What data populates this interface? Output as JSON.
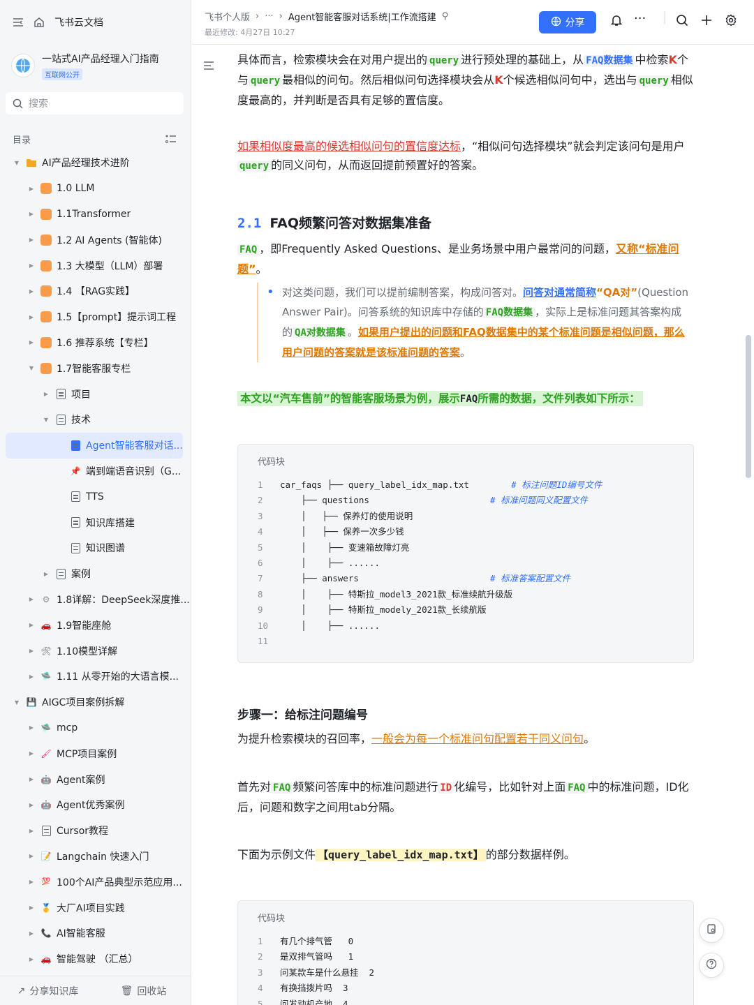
{
  "sidebar": {
    "brand": "飞书云文档",
    "kb_title": "一站式AI产品经理入门指南",
    "kb_tag": "互联网公开",
    "search_placeholder": "搜索",
    "toc_label": "目录",
    "items": [
      {
        "label": "AI产品经理技术进阶",
        "level": 0,
        "expanded": true,
        "icon": "folder-icon",
        "color": "#f5a623"
      },
      {
        "label": "1.0 LLM",
        "level": 1,
        "icon": "doc-orange-icon",
        "color": "#f89b4b"
      },
      {
        "label": "1.1Transformer",
        "level": 1,
        "icon": "doc-orange-icon",
        "color": "#f89b4b"
      },
      {
        "label": "1.2 AI Agents (智能体)",
        "level": 1,
        "icon": "doc-orange-icon",
        "color": "#f89b4b"
      },
      {
        "label": "1.3 大模型（LLM）部署",
        "level": 1,
        "icon": "doc-orange-icon",
        "color": "#f89b4b"
      },
      {
        "label": "1.4 【RAG实践】",
        "level": 1,
        "icon": "doc-orange-icon",
        "color": "#f89b4b"
      },
      {
        "label": "1.5【prompt】提示词工程",
        "level": 1,
        "icon": "doc-orange-icon",
        "color": "#f89b4b"
      },
      {
        "label": "1.6 推荐系统【专栏】",
        "level": 1,
        "icon": "doc-orange-icon",
        "color": "#f89b4b"
      },
      {
        "label": "1.7智能客服专栏",
        "level": 1,
        "expanded": true,
        "icon": "doc-orange-icon",
        "color": "#f89b4b"
      },
      {
        "label": "项目",
        "level": 2,
        "icon": "doc-icon"
      },
      {
        "label": "技术",
        "level": 2,
        "expanded": true,
        "icon": "doc-icon"
      },
      {
        "label": "Agent智能客服对话...",
        "level": 3,
        "active": true,
        "icon": "doc-blue-icon"
      },
      {
        "label": "端到端语音识别（G...",
        "level": 3,
        "icon": "pin-icon"
      },
      {
        "label": "TTS",
        "level": 3,
        "icon": "doc-icon"
      },
      {
        "label": "知识库搭建",
        "level": 3,
        "icon": "doc-icon"
      },
      {
        "label": "知识图谱",
        "level": 3,
        "icon": "doc-icon"
      },
      {
        "label": "案例",
        "level": 2,
        "icon": "doc-icon"
      },
      {
        "label": "1.8详解：DeepSeek深度推...",
        "level": 1,
        "icon": "gear-icon"
      },
      {
        "label": "1.9智能座舱",
        "level": 1,
        "icon": "car-icon"
      },
      {
        "label": "1.10模型详解",
        "level": 1,
        "icon": "tools-icon"
      },
      {
        "label": "1.11 从零开始的大语言模...",
        "level": 1,
        "icon": "ufo-icon"
      },
      {
        "label": "AIGC项目案例拆解",
        "level": 0,
        "expanded": true,
        "icon": "save-icon"
      },
      {
        "label": "mcp",
        "level": 1,
        "icon": "ufo-icon"
      },
      {
        "label": "MCP项目案例",
        "level": 1,
        "icon": "brush-icon"
      },
      {
        "label": "Agent案例",
        "level": 1,
        "icon": "robot-icon"
      },
      {
        "label": "Agent优秀案例",
        "level": 1,
        "icon": "robot-icon"
      },
      {
        "label": "Cursor教程",
        "level": 1,
        "icon": "doc-icon"
      },
      {
        "label": "Langchain 快速入门",
        "level": 1,
        "icon": "notepad-icon"
      },
      {
        "label": "100个AI产品典型示范应用...",
        "level": 1,
        "icon": "hundred-icon"
      },
      {
        "label": "大厂AI项目实践",
        "level": 1,
        "icon": "medal-icon"
      },
      {
        "label": "AI智能客服",
        "level": 1,
        "icon": "phone-icon"
      },
      {
        "label": "智能驾驶 （汇总）",
        "level": 1,
        "icon": "car-icon"
      }
    ],
    "bottom": {
      "share": "分享知识库",
      "recycle": "回收站"
    }
  },
  "header": {
    "crumbs": [
      "飞书个人版",
      "···",
      "Agent智能客服对话系统|工作流搭建"
    ],
    "modified": "最近修改: 4月27日 10:27",
    "share": "分享"
  },
  "doc": {
    "p1_a": "具体而言，检索模块会在对用户提出的",
    "query": "query",
    "p1_b": "进行预处理的基础上，从",
    "faq_set": "FAQ数据集",
    "p1_c": "中检索",
    "k": "K",
    "p1_d": "个与",
    "p1_e": "最相似的问句。然后相似问句选择模块会从",
    "p1_f": "个候选相似问句中，选出与",
    "p1_g": "相似度最高的，并判断是否具有足够的置信度。",
    "p2_red": "如果相似度最高的候选相似问句的置信度达标",
    "p2_a": "，“相似问句选择模块”就会判定该问句是用户",
    "p2_b": "的同义问句，从而返回提前预置好的答案。",
    "h2_num": "2.1",
    "h2_title": "FAQ频繁问答对数据集准备",
    "faq": "FAQ",
    "p3_a": "，即Frequently Asked Questions、是业务场景中用户最常问的问题，",
    "p3_orange": "又称“标准问题”",
    "p3_end": "。",
    "b_a": "对这类问题，我们可以提前编制答案，构成问答对。",
    "b_blue": "问答对通常简称",
    "b_qa": "“QA对”",
    "b_b": "(Question Answer Pair)。问答系统的知识库中存储的",
    "b_faqset": "FAQ数据集",
    "b_c": "，实际上是标准问题其答案构成的",
    "b_qaset": "QA对数据集",
    "b_d": "。",
    "b_orange": "如果用户提出的问题和FAQ数据集中的某个标准问题是相似问题，那么用户问题的答案就是该标准问题的答案",
    "b_end": "。",
    "hl_a": "本文以“汽车售前”的智能客服场景为例，展示",
    "hl_b": "所需的数据，文件列表如下所示：",
    "codeblock_title": "代码块",
    "code1": [
      {
        "ln": "1",
        "code": "car_faqs ├── query_label_idx_map.txt        ",
        "cm": "# 标注问题ID编号文件"
      },
      {
        "ln": "2",
        "code": "    ├── questions                       ",
        "cm": "# 标准问题同义配置文件"
      },
      {
        "ln": "3",
        "code": "    │   ├── 保养灯的使用说明",
        "cm": ""
      },
      {
        "ln": "4",
        "code": "    │   ├── 保养一次多少钱",
        "cm": ""
      },
      {
        "ln": "5",
        "code": "    │    ├── 变速箱故障灯亮",
        "cm": ""
      },
      {
        "ln": "6",
        "code": "    │    ├── ......",
        "cm": ""
      },
      {
        "ln": "7",
        "code": "    ├── answers                         ",
        "cm": "# 标准答案配置文件"
      },
      {
        "ln": "8",
        "code": "    │    ├── 特斯拉_model3_2021款_标准续航升级版",
        "cm": ""
      },
      {
        "ln": "9",
        "code": "    │    ├── 特斯拉_modely_2021款_长续航版",
        "cm": ""
      },
      {
        "ln": "10",
        "code": "    │    ├── ......",
        "cm": ""
      },
      {
        "ln": "11",
        "code": "",
        "cm": ""
      }
    ],
    "step1_title": "步骤一：给标注问题编号",
    "step1_a": "为提升检索模块的召回率，",
    "step1_orange": "一般会为每一个标准问句配置若干同义问句",
    "step1_end": "。",
    "p4_a": "首先对",
    "p4_b": "频繁问答库中的标准问题进行",
    "id": "ID",
    "p4_c": "化编号，比如针对上面",
    "p4_d": "中的标准问题，ID化后，问题和数字之间用tab分隔。",
    "p5_a": "下面为示例文件",
    "p5_file": "【query_label_idx_map.txt】",
    "p5_b": "的部分数据样例。",
    "code2": [
      {
        "ln": "1",
        "code": "有几个排气管   0"
      },
      {
        "ln": "2",
        "code": "是双排气管吗   1"
      },
      {
        "ln": "3",
        "code": "问某款车是什么悬挂  2"
      },
      {
        "ln": "4",
        "code": "有换挡拨片吗  3"
      },
      {
        "ln": "5",
        "code": "问发动机产地  4"
      }
    ]
  }
}
